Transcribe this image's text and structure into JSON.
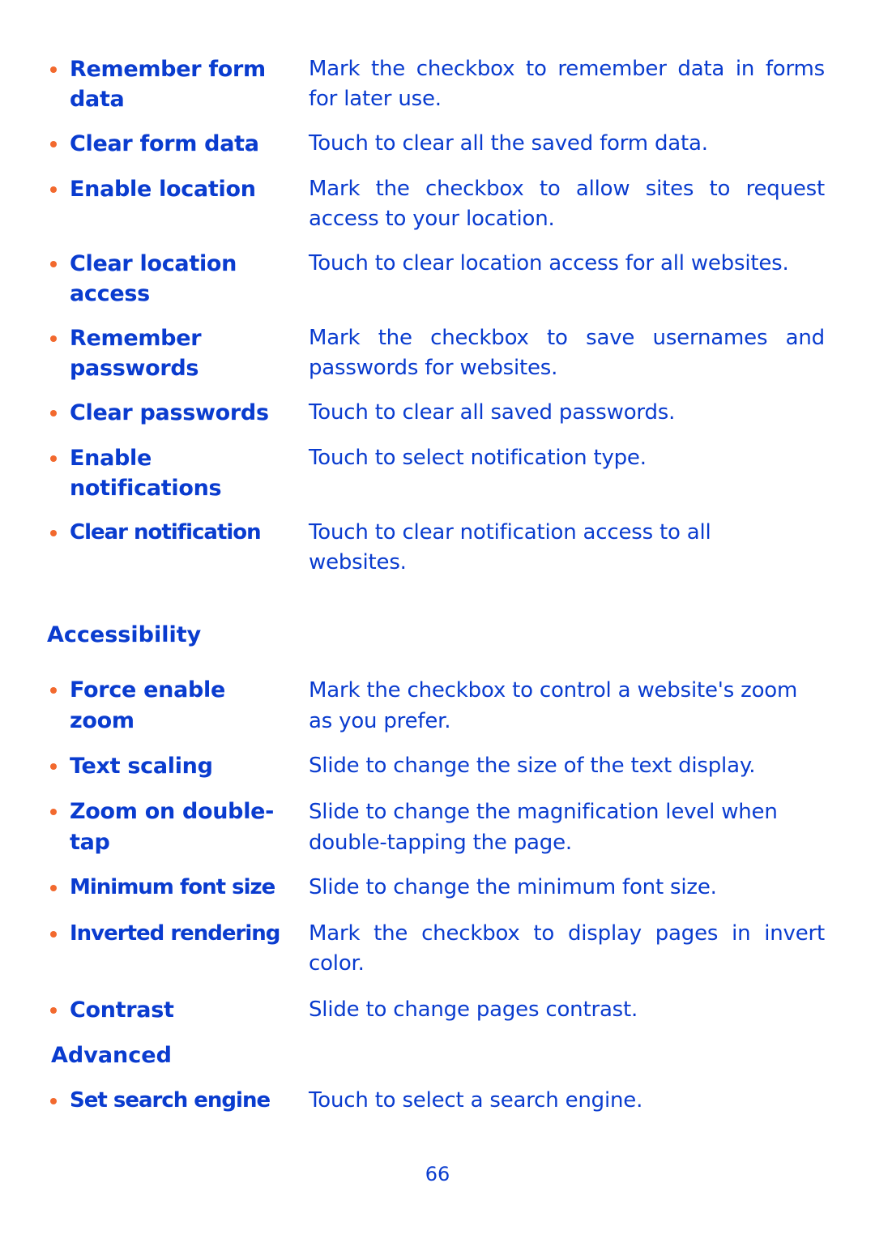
{
  "page": {
    "number": "66",
    "colors": {
      "text": "#0a3ccf",
      "bullet": "#f2692e"
    }
  },
  "items": [
    {
      "term": "Remember form data",
      "desc": "Mark the checkbox to remember data in forms for later use."
    },
    {
      "term": "Clear form data",
      "desc": "Touch to clear all the saved form data."
    },
    {
      "term": "Enable location",
      "desc": "Mark the checkbox to allow sites to request access to your location."
    },
    {
      "term": "Clear location access",
      "desc": "Touch to clear location access for all websites."
    },
    {
      "term": "Remember passwords",
      "desc": "Mark the checkbox to save usernames and passwords for websites."
    },
    {
      "term": "Clear passwords",
      "desc": "Touch to clear all saved passwords."
    },
    {
      "term": "Enable notifications",
      "desc": "Touch to select notification type."
    },
    {
      "term": "Clear notification",
      "desc": "Touch to clear notification access to all websites."
    }
  ],
  "sections": {
    "accessibility": {
      "heading": "Accessibility",
      "items": [
        {
          "term": "Force enable zoom",
          "desc": "Mark the checkbox to control a website's zoom as you prefer."
        },
        {
          "term": "Text scaling",
          "desc": "Slide to change the size of the text display."
        },
        {
          "term": "Zoom on double-tap",
          "desc": "Slide to change the magnification level when double-tapping the page."
        },
        {
          "term": "Minimum font size",
          "desc": "Slide to change the minimum font size."
        },
        {
          "term": "Inverted rendering",
          "desc": "Mark the checkbox to display pages in invert color."
        },
        {
          "term": "Contrast",
          "desc": "Slide to change pages contrast."
        }
      ]
    },
    "advanced": {
      "heading": "Advanced",
      "items": [
        {
          "term": "Set search engine",
          "desc": "Touch to select a search engine."
        }
      ]
    }
  }
}
